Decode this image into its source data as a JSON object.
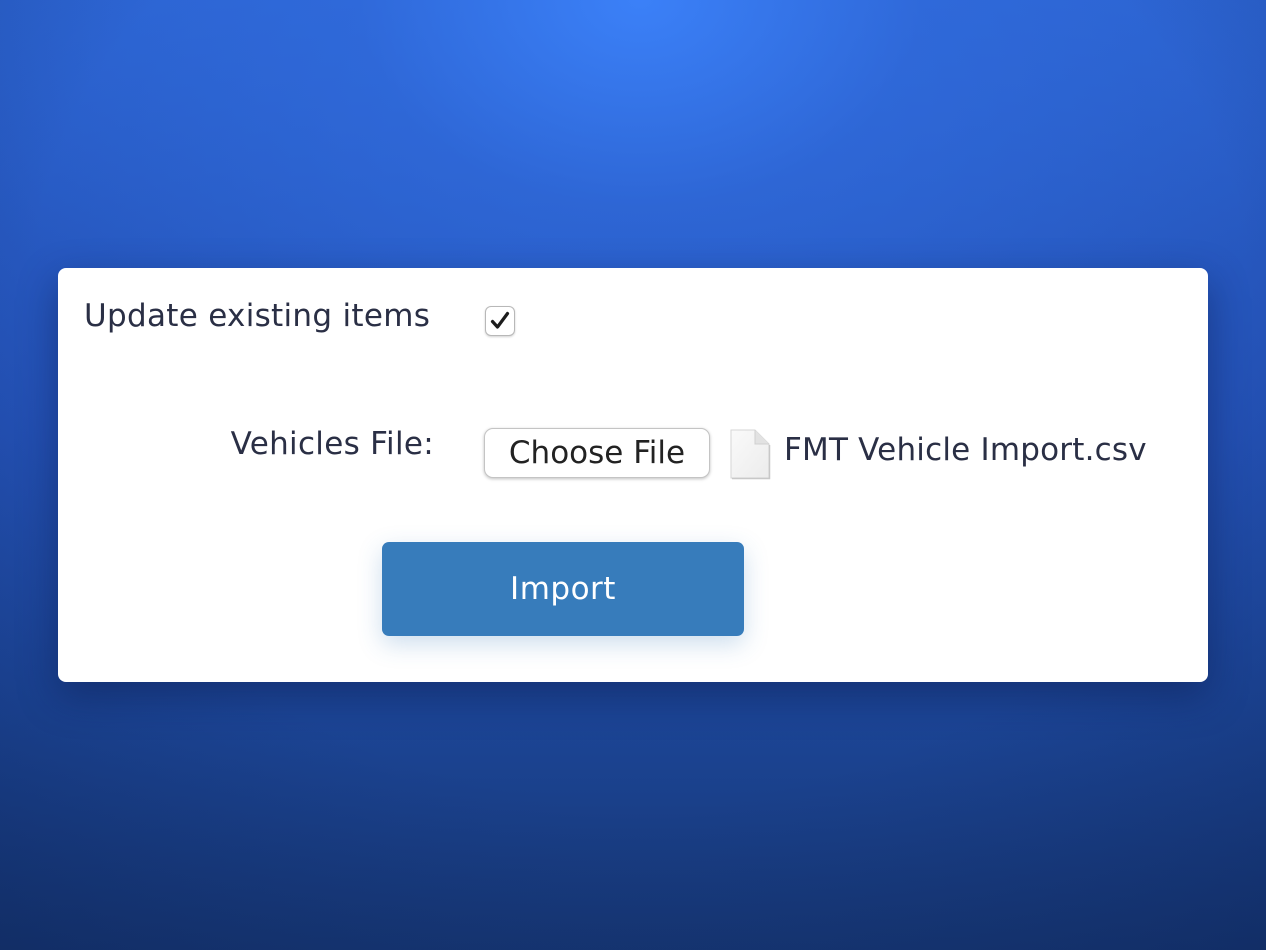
{
  "form": {
    "update_existing_label": "Update existing items",
    "update_existing_checked": true,
    "vehicles_file_label": "Vehicles File:",
    "choose_file_label": "Choose File",
    "selected_file_name": "FMT Vehicle Import.csv",
    "file_icon": "document-icon",
    "import_label": "Import"
  },
  "colors": {
    "background_top": "#3a7ff5",
    "background_bottom": "#173877",
    "card": "#ffffff",
    "text": "#2a2f45",
    "import_button": "#377cbb",
    "import_text": "#ffffff"
  }
}
